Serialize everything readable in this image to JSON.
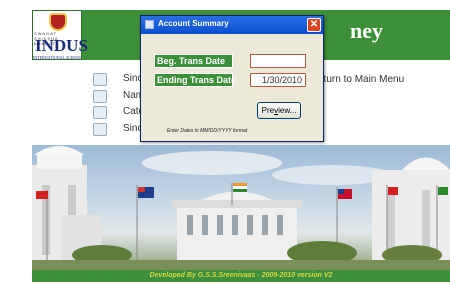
{
  "header": {
    "logo_top_text": "SWAGAT SHIKSHA BHARATI",
    "logo_name": "INDUS",
    "logo_sub": "INTERNATIONAL SCHOOL",
    "title_fragment": "ney",
    "color": "#3d8f3a"
  },
  "menu": {
    "items": [
      "Sinc",
      "Nam",
      "Cate",
      "Sinc"
    ],
    "return_label": "eturn to Main Menu"
  },
  "dialog": {
    "title": "Account Summary",
    "close_glyph": "✕",
    "beg_label": "Beg. Trans Date",
    "beg_value": "",
    "end_label": "Ending Trans Date",
    "end_value": "1/30/2010",
    "preview_label_pre": "Pre",
    "preview_label_u": "v",
    "preview_label_post": "iew...",
    "hint": "Enter Dates in MM/DD/YYYY format"
  },
  "footer": {
    "text": "Developed By G.S.S.Sreenivaas - 2009-2010 version V2"
  }
}
